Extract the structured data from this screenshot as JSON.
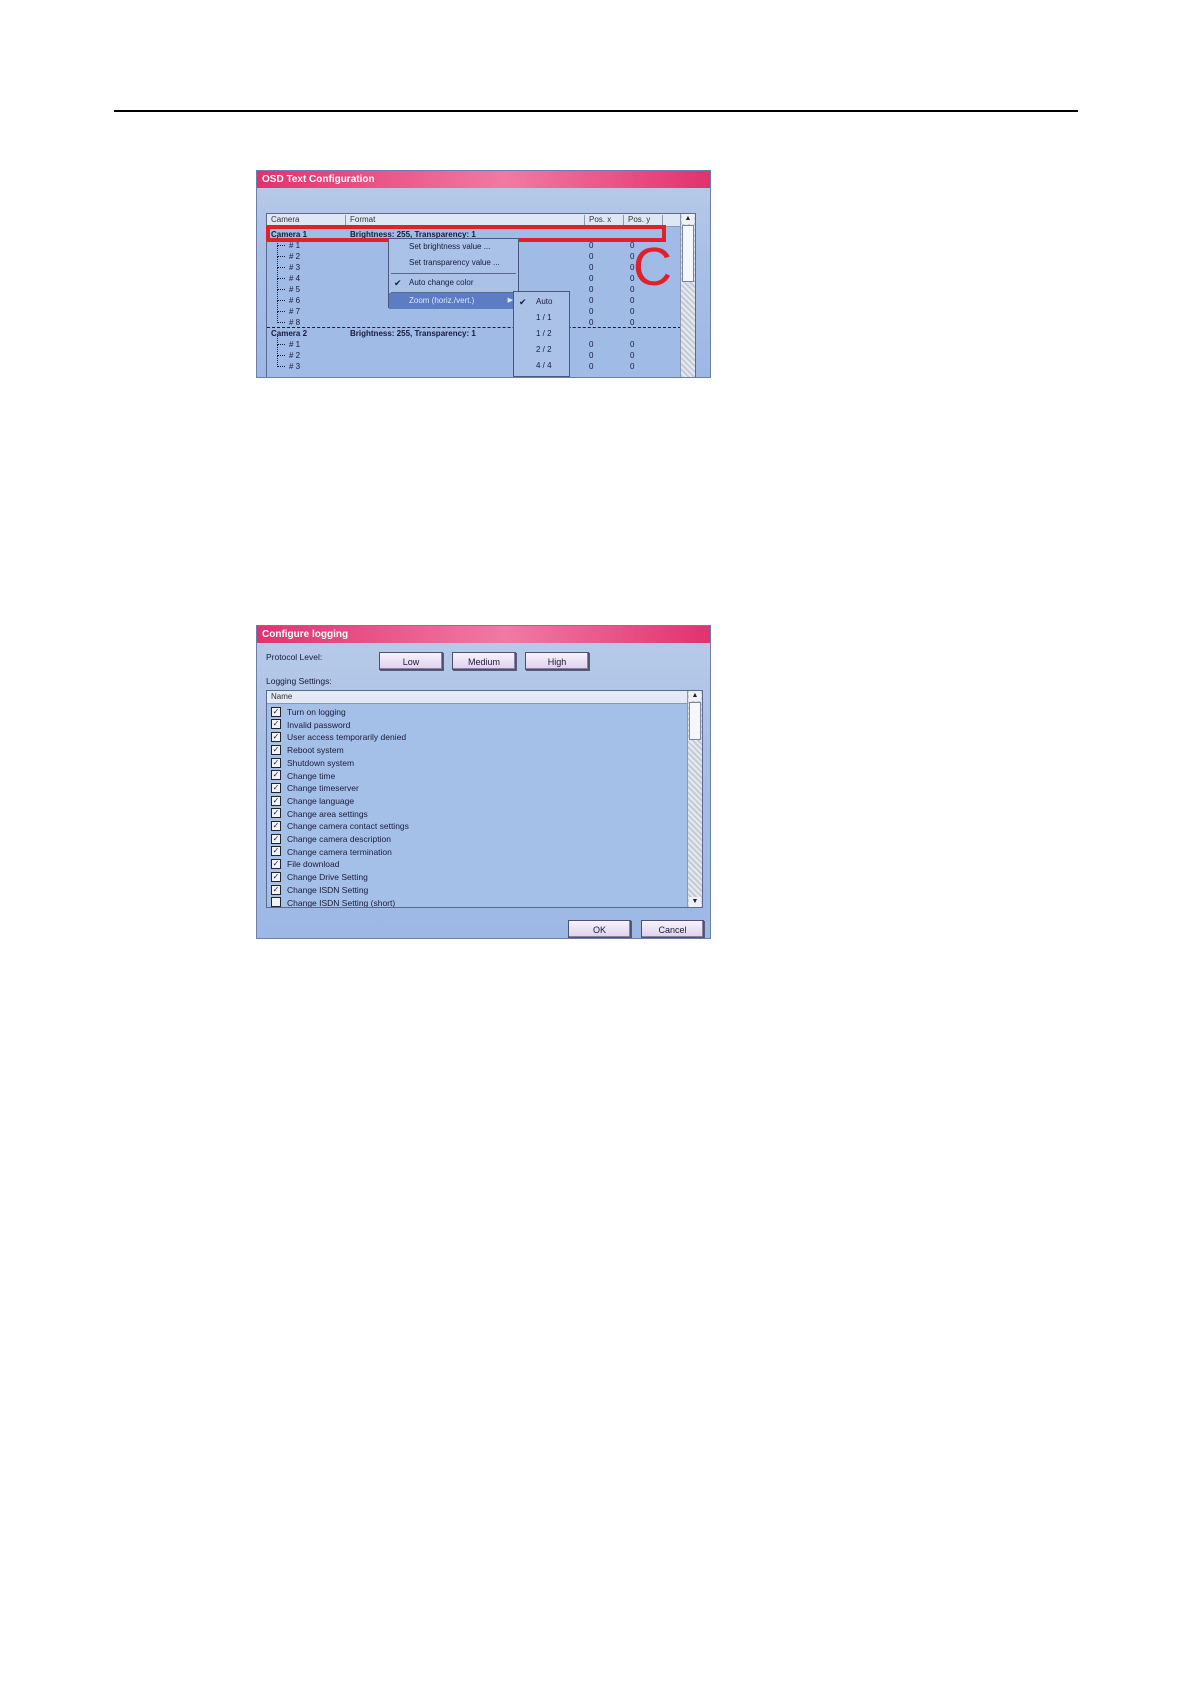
{
  "osd_window": {
    "title": "OSD Text Configuration",
    "columns": [
      "Camera",
      "Format",
      "Pos. x",
      "Pos. y"
    ],
    "rows": [
      {
        "type": "camera",
        "name": "Camera 1",
        "format": "Brightness: 255, Transparency: 1",
        "x": "",
        "y": ""
      },
      {
        "type": "sub",
        "name": "# 1",
        "x": "0",
        "y": "0"
      },
      {
        "type": "sub",
        "name": "# 2",
        "x": "0",
        "y": "0"
      },
      {
        "type": "sub",
        "name": "# 3",
        "x": "0",
        "y": "0"
      },
      {
        "type": "sub",
        "name": "# 4",
        "x": "0",
        "y": "0"
      },
      {
        "type": "sub",
        "name": "# 5",
        "x": "0",
        "y": "0"
      },
      {
        "type": "sub",
        "name": "# 6",
        "x": "0",
        "y": "0"
      },
      {
        "type": "sub",
        "name": "# 7",
        "x": "0",
        "y": "0"
      },
      {
        "type": "sub",
        "name": "# 8",
        "x": "0",
        "y": "0"
      },
      {
        "type": "camera",
        "name": "Camera 2",
        "format": "Brightness: 255, Transparency: 1",
        "x": "",
        "y": ""
      },
      {
        "type": "sub",
        "name": "# 1",
        "x": "0",
        "y": "0"
      },
      {
        "type": "sub",
        "name": "# 2",
        "x": "0",
        "y": "0"
      },
      {
        "type": "sub",
        "name": "# 3",
        "x": "0",
        "y": "0"
      }
    ],
    "context_menu": {
      "items": [
        "Set brightness value ...",
        "Set transparency value ...",
        "Auto change color",
        "Zoom (horiz./vert.)"
      ],
      "checked": "Auto change color",
      "highlighted": "Zoom (horiz./vert.)"
    },
    "zoom_submenu": {
      "items": [
        "Auto",
        "1 / 1",
        "1 / 2",
        "2 / 2",
        "4 / 4"
      ],
      "checked": "Auto"
    },
    "annotation_letter": "C",
    "annotation_color": "#e0202a"
  },
  "log_window": {
    "title": "Configure logging",
    "protocol_label": "Protocol Level:",
    "levels": [
      "Low",
      "Medium",
      "High"
    ],
    "settings_label": "Logging Settings:",
    "list_header": "Name",
    "items": [
      {
        "label": "Turn on logging",
        "checked": true
      },
      {
        "label": "Invalid password",
        "checked": true
      },
      {
        "label": "User access temporarily denied",
        "checked": true
      },
      {
        "label": "Reboot system",
        "checked": true
      },
      {
        "label": "Shutdown system",
        "checked": true
      },
      {
        "label": "Change time",
        "checked": true
      },
      {
        "label": "Change timeserver",
        "checked": true
      },
      {
        "label": "Change language",
        "checked": true
      },
      {
        "label": "Change area settings",
        "checked": true
      },
      {
        "label": "Change camera contact settings",
        "checked": true
      },
      {
        "label": "Change camera description",
        "checked": true
      },
      {
        "label": "Change camera termination",
        "checked": true
      },
      {
        "label": "File download",
        "checked": true
      },
      {
        "label": "Change Drive Setting",
        "checked": true
      },
      {
        "label": "Change ISDN Setting",
        "checked": true
      },
      {
        "label": "Change ISDN Setting (short)",
        "checked": false
      }
    ],
    "ok_label": "OK",
    "cancel_label": "Cancel"
  },
  "colors": {
    "title_accent": "#e2326e",
    "window_bg": "#a9c0e6",
    "highlight_red": "#e0202a"
  }
}
